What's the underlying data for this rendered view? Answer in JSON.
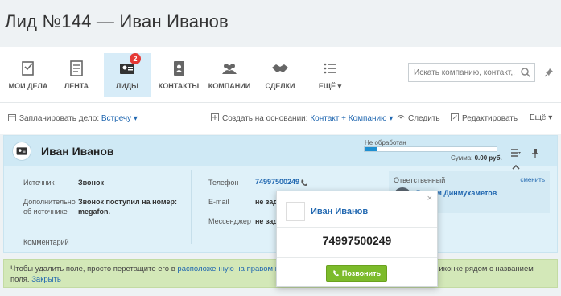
{
  "page": {
    "title": "Лид №144 — Иван Иванов"
  },
  "nav": {
    "items": [
      {
        "label": "МОИ ДЕЛА",
        "icon": "tasks-icon"
      },
      {
        "label": "ЛЕНТА",
        "icon": "feed-icon"
      },
      {
        "label": "ЛИДЫ",
        "icon": "leads-icon",
        "badge": "2",
        "active": true
      },
      {
        "label": "КОНТАКТЫ",
        "icon": "contacts-icon"
      },
      {
        "label": "КОМПАНИИ",
        "icon": "companies-icon"
      },
      {
        "label": "СДЕЛКИ",
        "icon": "deals-icon"
      },
      {
        "label": "ЕЩЁ ▾",
        "icon": "more-icon"
      }
    ],
    "search_placeholder": "Искать компанию, контакт, л"
  },
  "toolbar": {
    "plan_label": "Запланировать дело:",
    "plan_value": "Встречу ▾",
    "create_label": "Создать на основании:",
    "create_value": "Контакт + Компанию ▾",
    "follow": "Следить",
    "edit": "Редактировать",
    "more": "Ещё ▾"
  },
  "card": {
    "name": "Иван Иванов",
    "status_label": "Не обработан",
    "status_progress": 0.1,
    "sum_label": "Сумма:",
    "sum_value": "0.00 руб.",
    "source_label": "Источник",
    "source_value": "Звонок",
    "extra_source_label": "Дополнительно об источнике",
    "extra_source_value": "Звонок поступил на номер: megafon.",
    "comment_label": "Комментарий",
    "phone_label": "Телефон",
    "phone_value": "74997500249",
    "email_label": "E-mail",
    "email_value": "не зад",
    "messenger_label": "Мессенджер",
    "messenger_value": "не зад",
    "responsible_title": "Ответственный",
    "responsible_change": "сменить",
    "responsible_name": "Рустам Динмухаметов"
  },
  "hint": {
    "text1": "Чтобы удалить поле, просто перетащите его в",
    "link1": "расположенную на правом кра",
    "text2": "стным меню на иконке рядом с названием поля.",
    "close": "Закрыть"
  },
  "popup": {
    "name": "Иван Иванов",
    "phone": "74997500249",
    "call_label": "Позвонить",
    "close": "×"
  },
  "colors": {
    "accent": "#2067b0",
    "call_button": "#7cbb2b",
    "badge": "#e53935"
  }
}
